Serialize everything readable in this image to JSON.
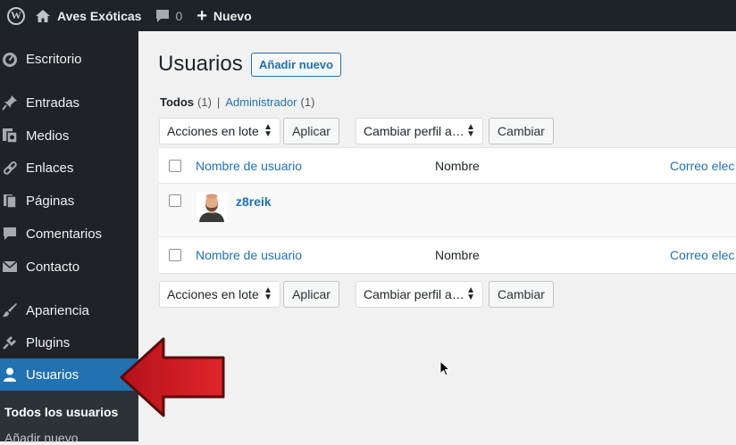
{
  "admin_bar": {
    "site_name": "Aves Exóticas",
    "comments_count": "0",
    "new_label": "Nuevo"
  },
  "sidebar": {
    "items": [
      {
        "label": "Escritorio",
        "icon": "dashboard-icon"
      },
      {
        "label": "Entradas",
        "icon": "pin-icon"
      },
      {
        "label": "Medios",
        "icon": "media-icon"
      },
      {
        "label": "Enlaces",
        "icon": "link-icon"
      },
      {
        "label": "Páginas",
        "icon": "pages-icon"
      },
      {
        "label": "Comentarios",
        "icon": "comment-icon"
      },
      {
        "label": "Contacto",
        "icon": "mail-icon"
      },
      {
        "label": "Apariencia",
        "icon": "brush-icon"
      },
      {
        "label": "Plugins",
        "icon": "plugin-icon"
      },
      {
        "label": "Usuarios",
        "icon": "user-icon",
        "active": true
      }
    ],
    "submenu": {
      "current": "Todos los usuarios",
      "other": "Añadir nuevo"
    }
  },
  "main": {
    "title": "Usuarios",
    "add_new": "Añadir nuevo",
    "filters": {
      "all_label": "Todos",
      "all_count": "(1)",
      "separator": "|",
      "admin_label": "Administrador",
      "admin_count": "(1)"
    },
    "bulk_actions": "Acciones en lote",
    "apply": "Aplicar",
    "change_role": "Cambiar perfil a…",
    "change": "Cambiar",
    "columns": {
      "username": "Nombre de usuario",
      "name": "Nombre",
      "email": "Correo elec"
    },
    "users": [
      {
        "username": "z8reik"
      }
    ]
  },
  "colors": {
    "admin_bar": "#1e2327",
    "sidebar": "#1f2327",
    "active_menu": "#2271b1",
    "link": "#2271b1",
    "arrow": "#d0181e"
  }
}
